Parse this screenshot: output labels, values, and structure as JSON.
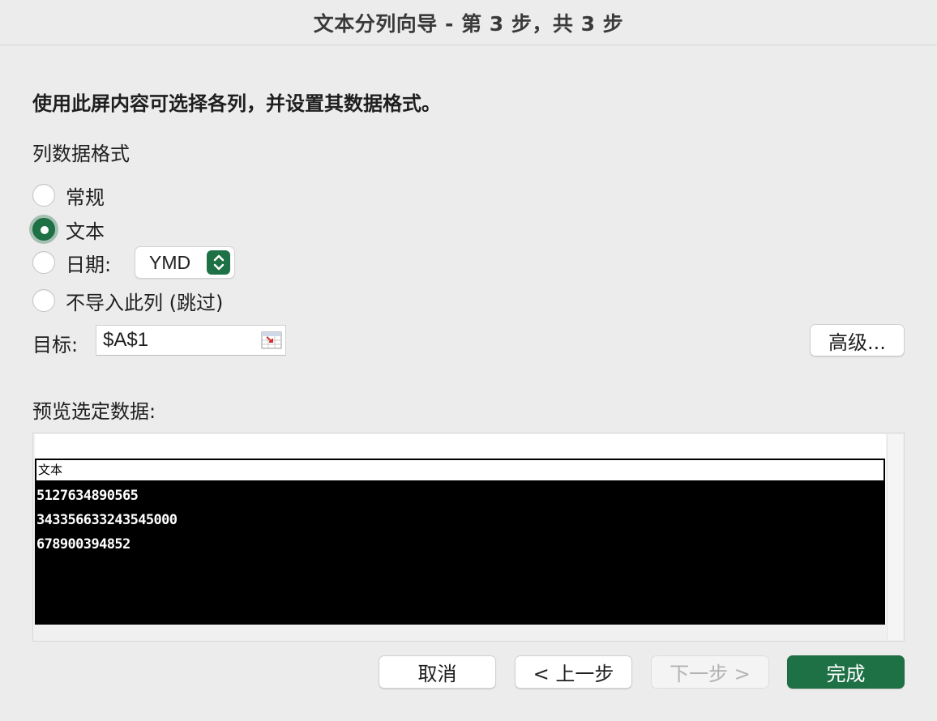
{
  "window": {
    "title": "文本分列向导 - 第 3 步，共 3 步"
  },
  "instruction": "使用此屏内容可选择各列，并设置其数据格式。",
  "column_format": {
    "label": "列数据格式",
    "options": [
      {
        "label": "常规",
        "selected": false
      },
      {
        "label": "文本",
        "selected": true
      },
      {
        "label": "日期:",
        "selected": false
      },
      {
        "label": "不导入此列 (跳过)",
        "selected": false
      }
    ],
    "date_format_value": "YMD"
  },
  "target": {
    "label": "目标:",
    "value": "$A$1"
  },
  "advanced_button": "高级...",
  "preview": {
    "label": "预览选定数据:",
    "header": "文本",
    "rows": [
      "5127634890565",
      "343356633243545000",
      "678900394852"
    ]
  },
  "buttons": {
    "cancel": "取消",
    "back": "< 上一步",
    "next": "下一步 >",
    "finish": "完成"
  },
  "colors": {
    "accent": "#1e7145",
    "background": "#ececec"
  }
}
